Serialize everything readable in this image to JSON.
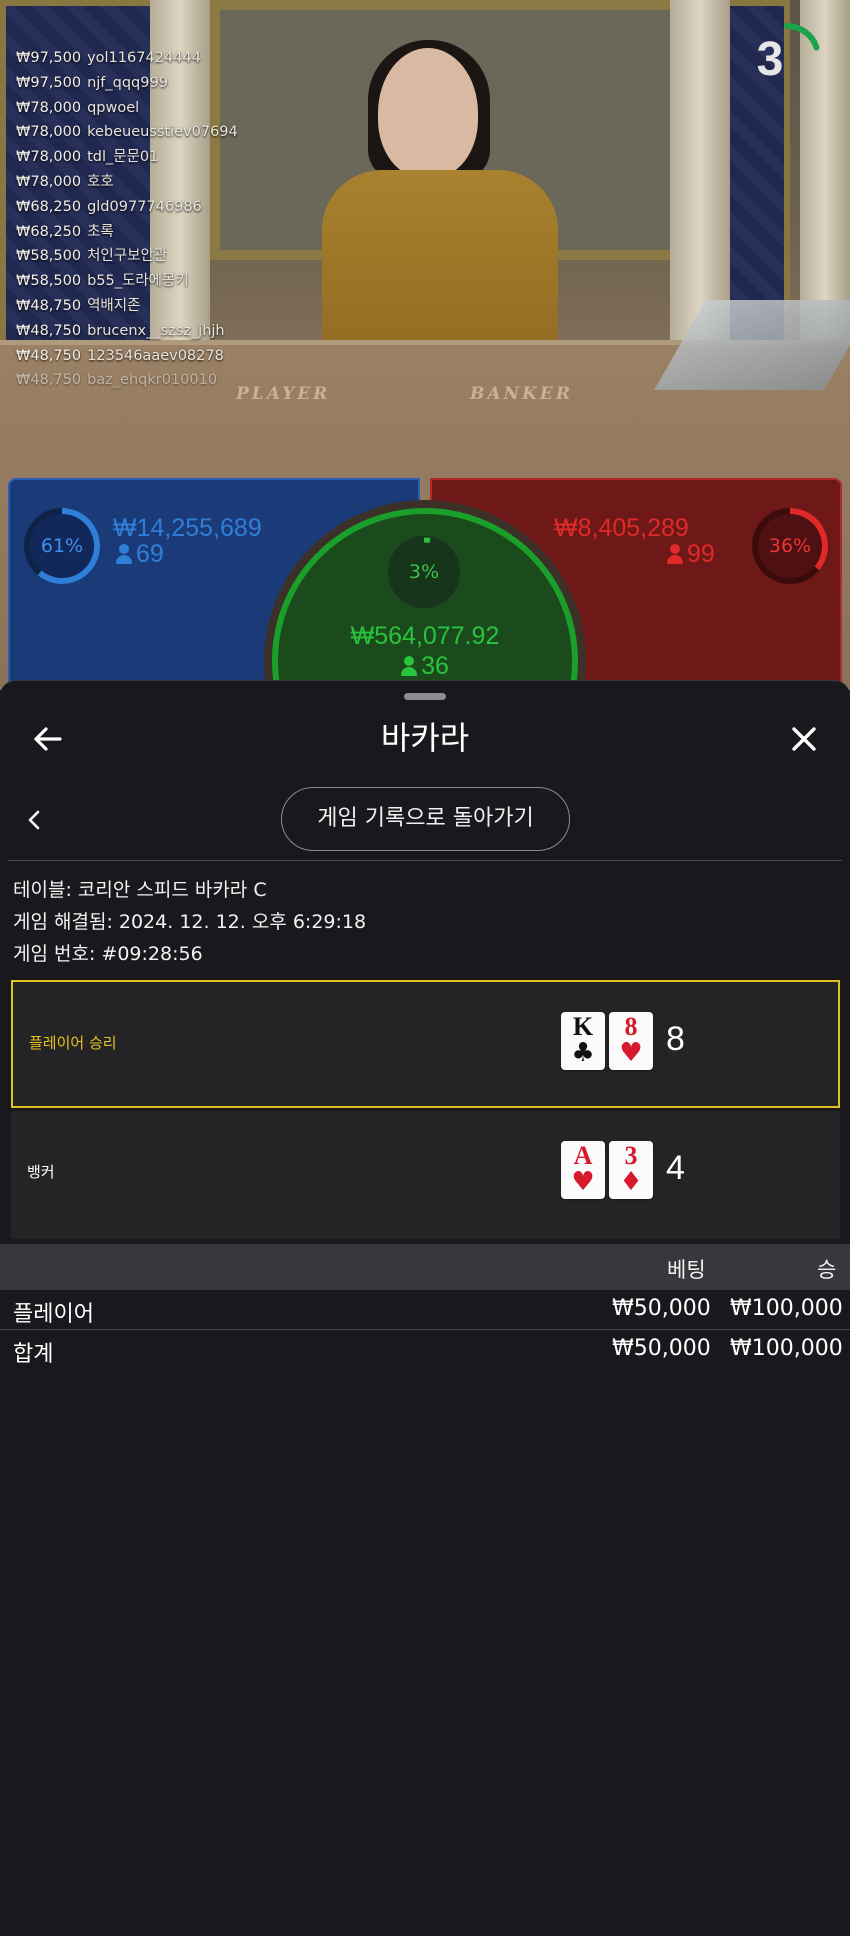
{
  "chat": [
    {
      "amount": "₩97,500",
      "user": "yol1167424444"
    },
    {
      "amount": "₩97,500",
      "user": "njf_qqq999"
    },
    {
      "amount": "₩78,000",
      "user": "qpwoel"
    },
    {
      "amount": "₩78,000",
      "user": "kebeueusstiev07694"
    },
    {
      "amount": "₩78,000",
      "user": "tdl_문문01"
    },
    {
      "amount": "₩78,000",
      "user": "호호"
    },
    {
      "amount": "₩68,250",
      "user": "gld0977746986"
    },
    {
      "amount": "₩68,250",
      "user": "초록"
    },
    {
      "amount": "₩58,500",
      "user": "처인구보안관"
    },
    {
      "amount": "₩58,500",
      "user": "b55_도라에몽키"
    },
    {
      "amount": "₩48,750",
      "user": "역배지존"
    },
    {
      "amount": "₩48,750",
      "user": "brucenx__szsz_jhjh"
    },
    {
      "amount": "₩48,750",
      "user": "123546aaev08278"
    },
    {
      "amount": "₩48,750",
      "user": "baz_ehqkr010010"
    }
  ],
  "countdown": {
    "value": "3",
    "fraction_remaining": 0.2,
    "color": "#1aa34a"
  },
  "table_felt": {
    "player_text": "PLAYER",
    "banker_text": "BANKER"
  },
  "betting": {
    "player": {
      "percent_label": "61%",
      "percent": 61,
      "amount": "₩14,255,689",
      "players": "69",
      "color": "#2f7fd8"
    },
    "banker": {
      "percent_label": "36%",
      "percent": 36,
      "amount": "₩8,405,289",
      "players": "99",
      "color": "#e02a2a"
    },
    "tie": {
      "percent_label": "3%",
      "percent": 3,
      "amount": "₩564,077.92",
      "players": "36",
      "color": "#29c43d"
    }
  },
  "sheet": {
    "title": "바카라",
    "back_icon": "back-arrow-icon",
    "close_icon": "close-icon",
    "history_button": "게임 기록으로 돌아가기",
    "table_line": "테이블: 코리안 스피드 바카라 C",
    "resolved_line": "게임 해결됨: 2024. 12. 12. 오후 6:29:18",
    "game_no_line": "게임 번호: #09:28:56"
  },
  "results": {
    "player": {
      "label": "플레이어 승리",
      "score": "8",
      "cards": [
        {
          "rank": "K",
          "suit": "♣",
          "color": "black"
        },
        {
          "rank": "8",
          "suit": "♥",
          "color": "red"
        }
      ],
      "highlight": "#e2c11d"
    },
    "banker": {
      "label": "뱅커",
      "score": "4",
      "cards": [
        {
          "rank": "A",
          "suit": "♥",
          "color": "red"
        },
        {
          "rank": "3",
          "suit": "♦",
          "color": "red"
        }
      ]
    }
  },
  "bets_table": {
    "headers": {
      "bet": "베팅",
      "win": "승"
    },
    "rows": [
      {
        "name": "플레이어",
        "bet": "₩50,000",
        "win": "₩100,000"
      }
    ],
    "total": {
      "name": "합계",
      "bet": "₩50,000",
      "win": "₩100,000"
    }
  }
}
